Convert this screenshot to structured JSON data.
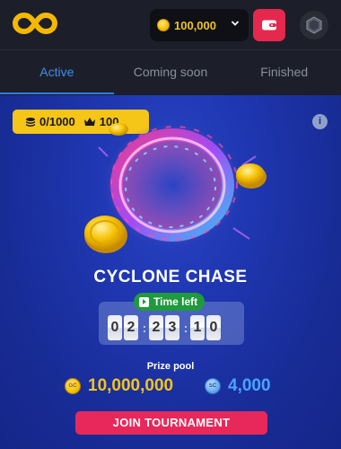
{
  "header": {
    "balance": "100,000",
    "icons": {
      "logo": "infinity-logo",
      "balance_coin": "gold-coin-icon",
      "dropdown": "chevron-down-icon",
      "wallet": "wallet-icon",
      "avatar": "user-avatar"
    }
  },
  "tabs": [
    {
      "label": "Active",
      "active": true
    },
    {
      "label": "Coming soon",
      "active": false
    },
    {
      "label": "Finished",
      "active": false
    }
  ],
  "tournament": {
    "players": "0/1000",
    "crown_value": "100",
    "title": "CYCLONE CHASE",
    "time_left_label": "Time left",
    "timer_digits": [
      "0",
      "2",
      "2",
      "3",
      "1",
      "0"
    ],
    "prize_pool_label": "Prize pool",
    "prize_gold_amount": "10,000,000",
    "prize_blue_amount": "4,000",
    "gold_coin_mark": "GC",
    "blue_coin_mark": "SC",
    "join_label": "JOIN TOURNAMENT",
    "info_icon": "i"
  },
  "colors": {
    "accent_blue": "#2f7de0",
    "gold": "#f5c518",
    "join_button": "#e8285a",
    "timer_badge": "#1f9a3d"
  }
}
